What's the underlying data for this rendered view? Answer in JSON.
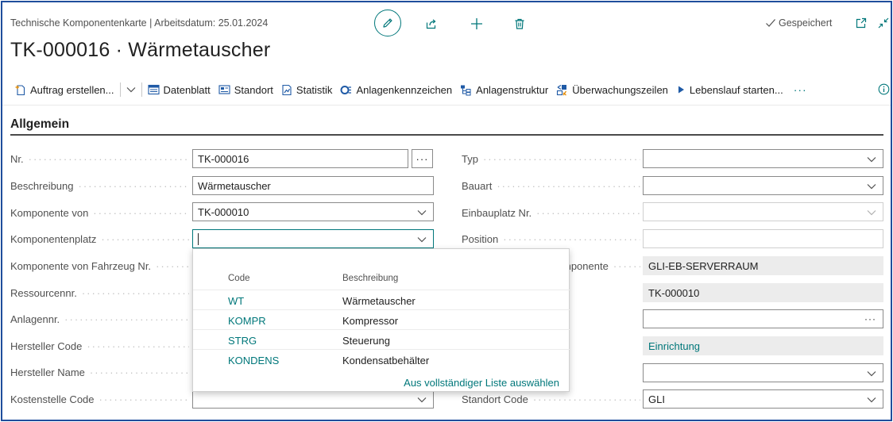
{
  "header": {
    "caption": "Technische Komponentenkarte | Arbeitsdatum: 25.01.2024",
    "title": "TK-000016 · Wärmetauscher",
    "saved_status": "Gespeichert"
  },
  "icons": {
    "edit": "pencil-icon",
    "share": "share-icon",
    "add": "plus-icon",
    "delete": "trash-icon",
    "open_new_window": "open-in-new-window-icon",
    "collapse": "collapse-icon",
    "info": "info-icon"
  },
  "actions": [
    {
      "label": "Auftrag erstellen...",
      "icon": "new-order-icon"
    },
    {
      "label": "Datenblatt",
      "icon": "datasheet-icon"
    },
    {
      "label": "Standort",
      "icon": "location-icon"
    },
    {
      "label": "Statistik",
      "icon": "statistics-icon"
    },
    {
      "label": "Anlagenkennzeichen",
      "icon": "plant-identifier-icon"
    },
    {
      "label": "Anlagenstruktur",
      "icon": "plant-structure-icon"
    },
    {
      "label": "Überwachungszeilen",
      "icon": "monitoring-lines-icon"
    },
    {
      "label": "Lebenslauf starten...",
      "icon": "play-icon"
    }
  ],
  "more_actions": "···",
  "section": {
    "title": "Allgemein"
  },
  "fields_left": [
    {
      "label": "Nr.",
      "value": "TK-000016"
    },
    {
      "label": "Beschreibung",
      "value": "Wärmetauscher"
    },
    {
      "label": "Komponente von",
      "value": "TK-000010"
    },
    {
      "label": "Komponentenplatz",
      "value": ""
    },
    {
      "label": "Komponente von Fahrzeug Nr.",
      "value": ""
    },
    {
      "label": "Ressourcennr.",
      "value": ""
    },
    {
      "label": "Anlagennr.",
      "value": ""
    },
    {
      "label": "Hersteller Code",
      "value": ""
    },
    {
      "label": "Hersteller Name",
      "value": ""
    },
    {
      "label": "Kostenstelle Code",
      "value": ""
    }
  ],
  "fields_right": [
    {
      "label": "Typ",
      "value": ""
    },
    {
      "label": "Bauart",
      "value": ""
    },
    {
      "label": "Einbauplatz Nr.",
      "value": ""
    },
    {
      "label": "Position",
      "value": ""
    },
    {
      "label": "mponente",
      "value": "GLI-EB-SERVERRAUM"
    },
    {
      "label": "",
      "value": "TK-000010"
    },
    {
      "label": "",
      "value": ""
    },
    {
      "label": "",
      "value": "Einrichtung"
    },
    {
      "label": "",
      "value": ""
    },
    {
      "label": "Standort Code",
      "value": "GLI"
    }
  ],
  "assist_button": "···",
  "dropdown": {
    "col_code": "Code",
    "col_desc": "Beschreibung",
    "rows": [
      {
        "code": "WT",
        "desc": "Wärmetauscher"
      },
      {
        "code": "KOMPR",
        "desc": "Kompressor"
      },
      {
        "code": "STRG",
        "desc": "Steuerung"
      },
      {
        "code": "KONDENS",
        "desc": "Kondensatbehälter"
      }
    ],
    "footer": "Aus vollständiger Liste auswählen"
  },
  "colors": {
    "accent": "#00777a",
    "border": "#1f4e9c",
    "text": "#212121",
    "muted": "#505050"
  }
}
